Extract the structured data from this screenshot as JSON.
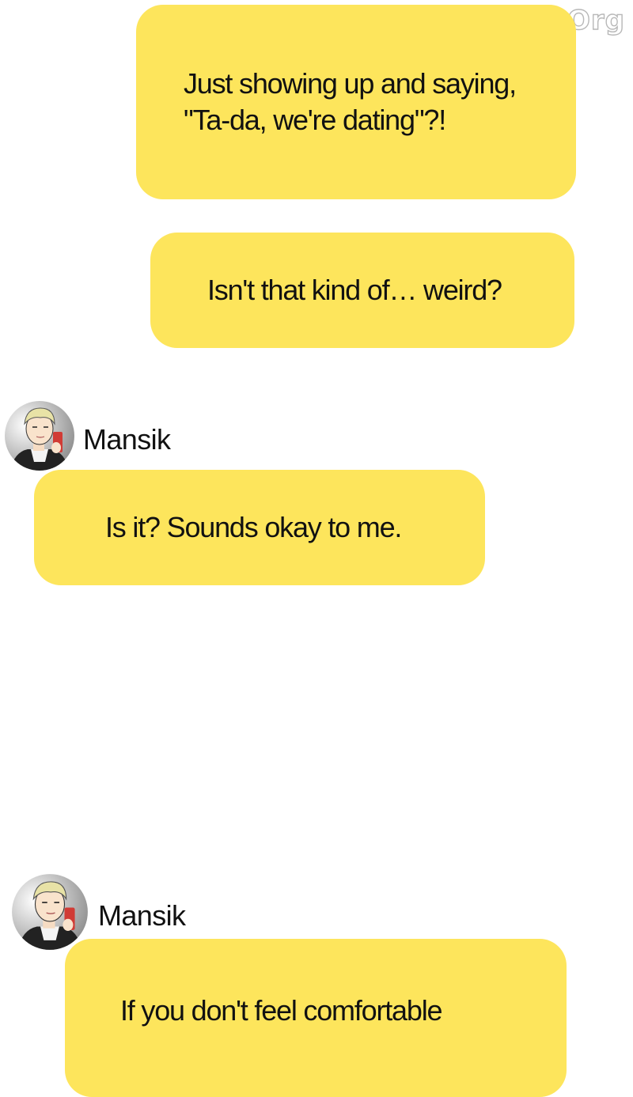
{
  "watermark": "MangaYY.Org",
  "messages": [
    {
      "text": "Just showing up and saying,\n\"Ta-da, we're dating\"?!"
    },
    {
      "text": "Isn't that kind of… weird?"
    },
    {
      "text": "Is it? Sounds okay to me."
    },
    {
      "text": "If you don't feel comfortable"
    }
  ],
  "senders": [
    {
      "name": "Mansik",
      "avatar_icon": "character-avatar-icon"
    },
    {
      "name": "Mansik",
      "avatar_icon": "character-avatar-icon"
    }
  ],
  "colors": {
    "bubble": "#fde55c",
    "text": "#111111",
    "background": "#ffffff"
  }
}
